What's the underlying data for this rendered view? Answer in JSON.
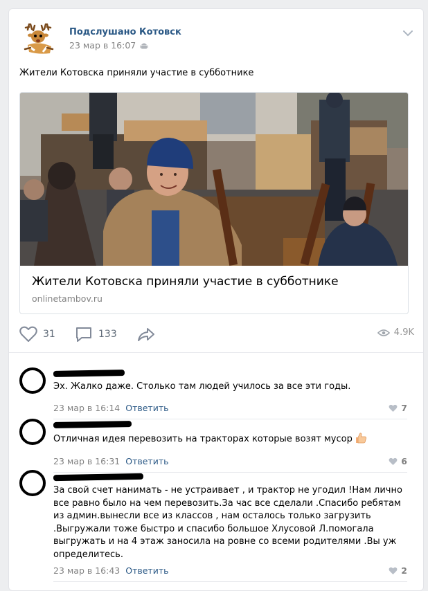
{
  "post": {
    "group_name": "Подслушано Котовск",
    "date": "23 мар в 16:07",
    "text": "Жители Котовска приняли участие в субботнике",
    "link": {
      "title": "Жители Котовска приняли участие в субботнике",
      "domain": "onlinetambov.ru"
    },
    "likes": "31",
    "comments": "133",
    "views": "4.9K"
  },
  "comments": [
    {
      "text": "Эх. Жалко даже. Столько там людей училось за все эти годы.",
      "date": "23 мар в 16:14",
      "reply": "Ответить",
      "likes": "7"
    },
    {
      "text": "Отличная идея перевозить на тракторах которые возят мусор",
      "date": "23 мар в 16:31",
      "reply": "Ответить",
      "likes": "6"
    },
    {
      "text": "За свой счет нанимать - не устраивает , и трактор не угодил !Нам лично все равно было на чем перевозить.За час все сделали .Спасибо ребятам из админ.вынесли все из классов , нам осталось только загрузить .Выгружали тоже быстро и спасибо большое Хлусовой Л.помогала выгружать и на 4 этаж заносила на ровне со всеми родителями .Вы уж определитесь.",
      "date": "23 мар в 16:43",
      "reply": "Ответить",
      "likes": "2"
    }
  ]
}
